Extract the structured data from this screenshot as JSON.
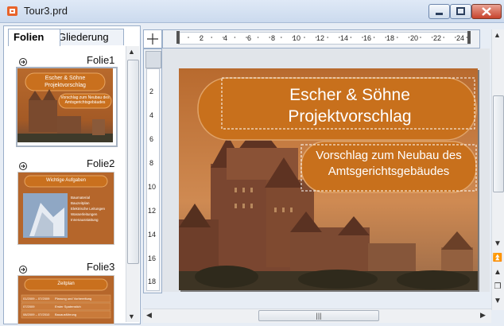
{
  "window": {
    "title": "Tour3.prd"
  },
  "tabs": [
    {
      "label": "Folien"
    },
    {
      "label": "Gliederung"
    }
  ],
  "slides": [
    {
      "label": "Folie1",
      "title": "Escher & Söhne Projektvorschlag",
      "subtitle": "Vorschlag zum Neubau des Amtsgerichtsgebäudes"
    },
    {
      "label": "Folie2",
      "title": "Wichtige Aufgaben",
      "bullets": [
        "Baumaterial",
        "Bauzeitplan",
        "Elektrische Leitungen",
        "Wasserleitungen",
        "Innenausstattung"
      ]
    },
    {
      "label": "Folie3",
      "title": "Zeitplan",
      "rows": [
        [
          "01/2009 – 07/2009",
          "Planung und Vorbereitung"
        ],
        [
          "07/2009",
          "Erster Spatenstich"
        ],
        [
          "08/2009 – 07/2010",
          "Bauausführung"
        ]
      ]
    }
  ],
  "main_slide": {
    "title": "Escher & Söhne\nProjektvorschlag",
    "subtitle": "Vorschlag zum Neubau des\nAmtsgerichtsgebäudes"
  },
  "ruler": {
    "horizontal": [
      "2",
      "4",
      "6",
      "8",
      "10",
      "12",
      "14",
      "16",
      "18",
      "20",
      "22",
      "24"
    ],
    "vertical": [
      "2",
      "4",
      "6",
      "8",
      "10",
      "12",
      "14",
      "16",
      "18"
    ]
  },
  "colors": {
    "slide_orange": "#c8701c",
    "title_text": "#ffffff"
  },
  "icons": {
    "app": "presentation-icon",
    "minimize": "minimize-icon",
    "maximize": "maximize-icon",
    "close": "close-icon"
  }
}
